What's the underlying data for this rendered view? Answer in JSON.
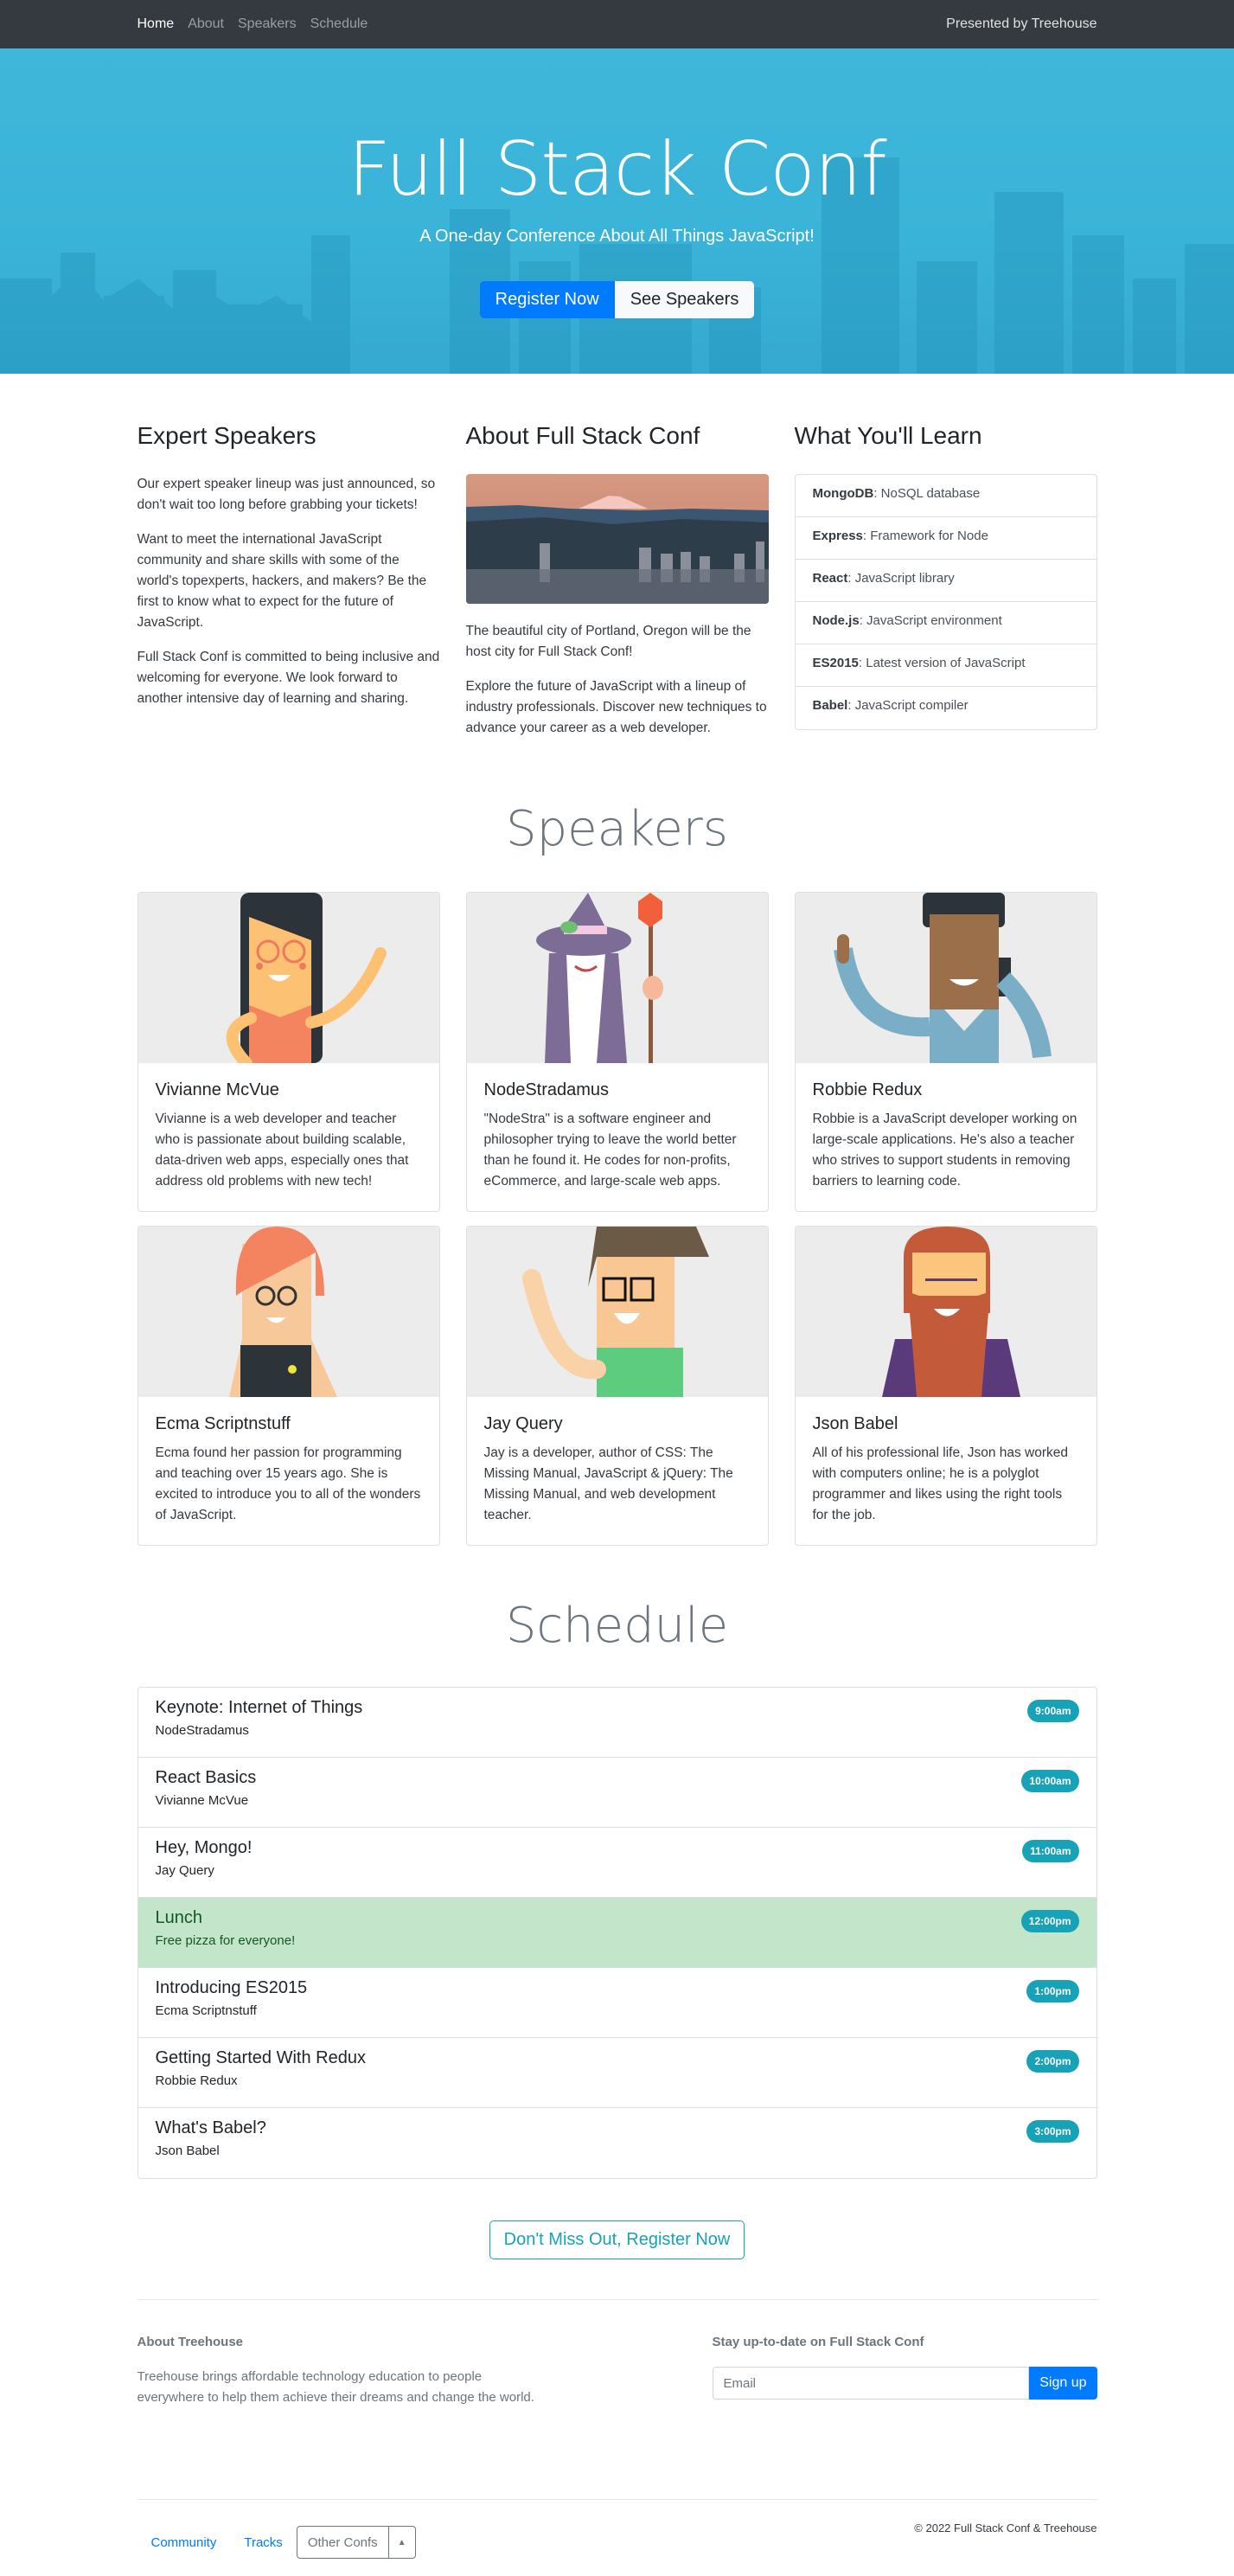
{
  "nav": {
    "links": [
      {
        "label": "Home",
        "active": true
      },
      {
        "label": "About",
        "active": false
      },
      {
        "label": "Speakers",
        "active": false
      },
      {
        "label": "Schedule",
        "active": false
      }
    ],
    "right_text": "Presented by Treehouse"
  },
  "hero": {
    "title": "Full Stack Conf",
    "subtitle": "A One-day Conference About All Things JavaScript!",
    "primary_button": "Register Now",
    "secondary_button": "See Speakers"
  },
  "intro": {
    "expert": {
      "heading": "Expert Speakers",
      "paragraphs": [
        "Our expert speaker lineup was just announced, so don't wait too long before grabbing your tickets!",
        "Want to meet the international JavaScript community and share skills with some of the world's topexperts, hackers, and makers? Be the first to know what to expect for the future of JavaScript.",
        "Full Stack Conf is committed to being inclusive and welcoming for everyone. We look forward to another intensive day of learning and sharing."
      ]
    },
    "about": {
      "heading": "About Full Stack Conf",
      "image_alt": "Portland skyline with Mount Hood",
      "paragraphs": [
        "The beautiful city of Portland, Oregon will be the host city for Full Stack Conf!",
        "Explore the future of JavaScript with a lineup of industry professionals. Discover new techniques to advance your career as a web developer."
      ]
    },
    "learn": {
      "heading": "What You'll Learn",
      "items": [
        {
          "term": "MongoDB",
          "desc": ": NoSQL database"
        },
        {
          "term": "Express",
          "desc": ": Framework for Node"
        },
        {
          "term": "React",
          "desc": ": JavaScript library"
        },
        {
          "term": "Node.js",
          "desc": ": JavaScript environment"
        },
        {
          "term": "ES2015",
          "desc": ": Latest version of JavaScript"
        },
        {
          "term": "Babel",
          "desc": ": JavaScript compiler"
        }
      ]
    }
  },
  "speakers": {
    "heading": "Speakers",
    "items": [
      {
        "name": "Vivianne McVue",
        "bio": "Vivianne is a web developer and teacher who is passionate about building scalable, data-driven web apps, especially ones that address old problems with new tech!"
      },
      {
        "name": "NodeStradamus",
        "bio": "\"NodeStra\" is a software engineer and philosopher trying to leave the world better than he found it. He codes for non-profits, eCommerce, and large-scale web apps."
      },
      {
        "name": "Robbie Redux",
        "bio": "Robbie is a JavaScript developer working on large-scale applications. He's also a teacher who strives to support students in removing barriers to learning code."
      },
      {
        "name": "Ecma Scriptnstuff",
        "bio": "Ecma found her passion for programming and teaching over 15 years ago. She is excited to introduce you to all of the wonders of JavaScript."
      },
      {
        "name": "Jay Query",
        "bio": "Jay is a developer, author of CSS: The Missing Manual, JavaScript & jQuery: The Missing Manual, and web development teacher."
      },
      {
        "name": "Json Babel",
        "bio": "All of his professional life, Json has worked with computers online; he is a polyglot programmer and likes using the right tools for the job."
      }
    ]
  },
  "schedule": {
    "heading": "Schedule",
    "items": [
      {
        "title": "Keynote: Internet of Things",
        "sub": "NodeStradamus",
        "time": "9:00am"
      },
      {
        "title": "React Basics",
        "sub": "Vivianne McVue",
        "time": "10:00am"
      },
      {
        "title": "Hey, Mongo!",
        "sub": "Jay Query",
        "time": "11:00am"
      },
      {
        "title": "Lunch",
        "sub": "Free pizza for everyone!",
        "time": "12:00pm",
        "highlight": true
      },
      {
        "title": "Introducing ES2015",
        "sub": "Ecma Scriptnstuff",
        "time": "1:00pm"
      },
      {
        "title": "Getting Started With Redux",
        "sub": "Robbie Redux",
        "time": "2:00pm"
      },
      {
        "title": "What's Babel?",
        "sub": "Json Babel",
        "time": "3:00pm"
      }
    ]
  },
  "cta": {
    "label": "Don't Miss Out, Register Now"
  },
  "footer": {
    "about_heading": "About Treehouse",
    "about_text": "Treehouse brings affordable technology education to people everywhere to help them achieve their dreams and change the world.",
    "subscribe_heading": "Stay up-to-date on Full Stack Conf",
    "email_placeholder": "Email",
    "email_value": "",
    "signup_label": "Sign up",
    "links": [
      "Community",
      "Tracks"
    ],
    "dropdown_label": "Other Confs",
    "copyright": "© 2022 Full Stack Conf & Treehouse"
  },
  "colors": {
    "navbar": "#343a40",
    "hero": "#3ab3d8",
    "primary": "#007bff",
    "info": "#17a2b8",
    "success_bg": "#c3e6cb"
  }
}
